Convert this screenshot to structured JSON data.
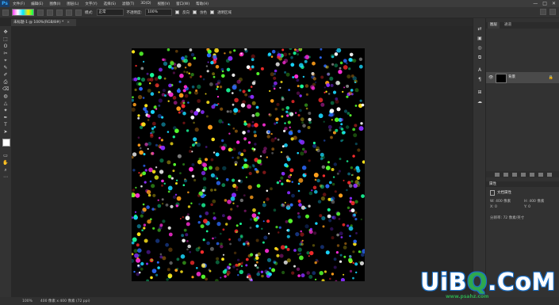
{
  "app": {
    "logo": "Ps"
  },
  "menu": {
    "items": [
      "文件(F)",
      "编辑(E)",
      "图像(I)",
      "图层(L)",
      "文字(Y)",
      "选择(S)",
      "滤镜(T)",
      "3D(D)",
      "视图(V)",
      "窗口(W)",
      "帮助(H)"
    ]
  },
  "window_controls": [
    "—",
    "□",
    "✕"
  ],
  "options_bar": {
    "mode_label": "模式:",
    "mode_value": "正常",
    "opacity_label": "不透明度:",
    "opacity_value": "100%",
    "reverse_label": "反向",
    "dither_label": "仿色",
    "transparency_label": "透明区域"
  },
  "document": {
    "tab_label": "未标题-1 @ 100%(RGB/8#) *",
    "close_glyph": "×"
  },
  "tools": [
    "✥",
    "⬚",
    "ʘ",
    "✂",
    "⌖",
    "✎",
    "✐",
    "⎙",
    "⌫",
    "◍",
    "△",
    "✦",
    "✒",
    "T",
    "➤",
    "▭",
    "✋",
    "⌕",
    "⋯"
  ],
  "dock_icons": [
    "⇄",
    "▣",
    "◎",
    "⧉",
    "A",
    "¶",
    "⊞",
    "☁"
  ],
  "layers_panel": {
    "tabs": [
      "图层",
      "通道"
    ],
    "layer": {
      "name": "背景",
      "lock_glyph": "🔒",
      "eye_glyph": "👁"
    }
  },
  "properties_panel": {
    "header": "属性",
    "title": "文档属性",
    "fields": [
      {
        "label": "W: 400 像素",
        "pos": "a"
      },
      {
        "label": "H: 400 像素",
        "pos": "b"
      },
      {
        "label": "X: 0",
        "pos": "c"
      },
      {
        "label": "Y: 0",
        "pos": "d"
      },
      {
        "label": "分辨率: 72 像素/英寸",
        "pos": "e"
      }
    ]
  },
  "status": {
    "zoom": "100%",
    "doc_info": "400 像素 x 400 像素 (72 ppi)"
  },
  "watermark": {
    "main_before": "UiB",
    "main_q": "Q",
    "main_after": ".CoM",
    "sub": "www.psahz.com"
  },
  "colors": {
    "accent": "#31a8ff",
    "particles": [
      "#ff2d2d",
      "#ff9f1a",
      "#ffe61a",
      "#57ff2d",
      "#1aff9c",
      "#1ad8ff",
      "#2d6bff",
      "#8a2dff",
      "#ff2dd8",
      "#ffffff"
    ]
  }
}
